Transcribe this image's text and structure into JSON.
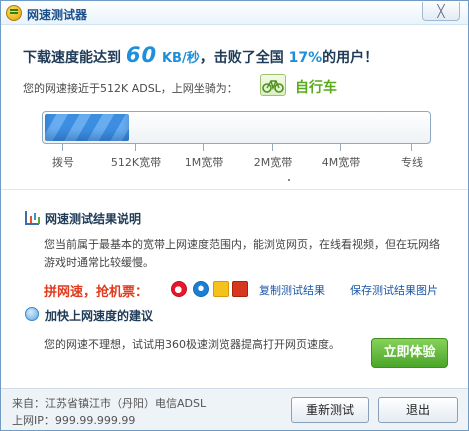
{
  "window": {
    "title": "网速测试器",
    "close_label": "╳"
  },
  "result": {
    "prefix": "下载速度能达到",
    "speed": "60",
    "unit": "KB/秒",
    "mid": "，击败了全国",
    "percent": "17%",
    "suffix": "的用户！"
  },
  "network": {
    "description": "您的网速接近于512K ADSL，上网坐骑为：",
    "vehicle_icon": "bicycle-icon",
    "vehicle": "自行车"
  },
  "progress": {
    "fraction": 0.22,
    "fill_color": "#3d8ee0",
    "ticks": [
      "拨号",
      "512K宽带",
      "1M宽带",
      "2M宽带",
      "4M宽带",
      "专线"
    ]
  },
  "explanation": {
    "icon": "chart-icon",
    "title": "网速测试结果说明",
    "text": "您当前属于最基本的宽带上网速度范围内，能浏览网页，在线看视频，但在玩网络游戏时通常比较缓慢。"
  },
  "share": {
    "label": "拼网速，抢机票：",
    "icons": [
      "weibo-icon",
      "tencent-weibo-icon",
      "renren-icon",
      "kaixin-icon"
    ],
    "copy_link": "复制测试结果",
    "save_link": "保存测试结果图片"
  },
  "suggestion": {
    "icon": "lightbulb-icon",
    "title": "加快上网速度的建议",
    "text": "您的网速不理想，试试用360极速浏览器提高打开网页速度。",
    "button": "立即体验",
    "button_color": "#4aa628"
  },
  "footer": {
    "origin": "来自：江苏省镇江市（丹阳）电信ADSL",
    "ip": "上网IP：999.99.999.99",
    "retest_button": "重新测试",
    "exit_button": "退出"
  }
}
